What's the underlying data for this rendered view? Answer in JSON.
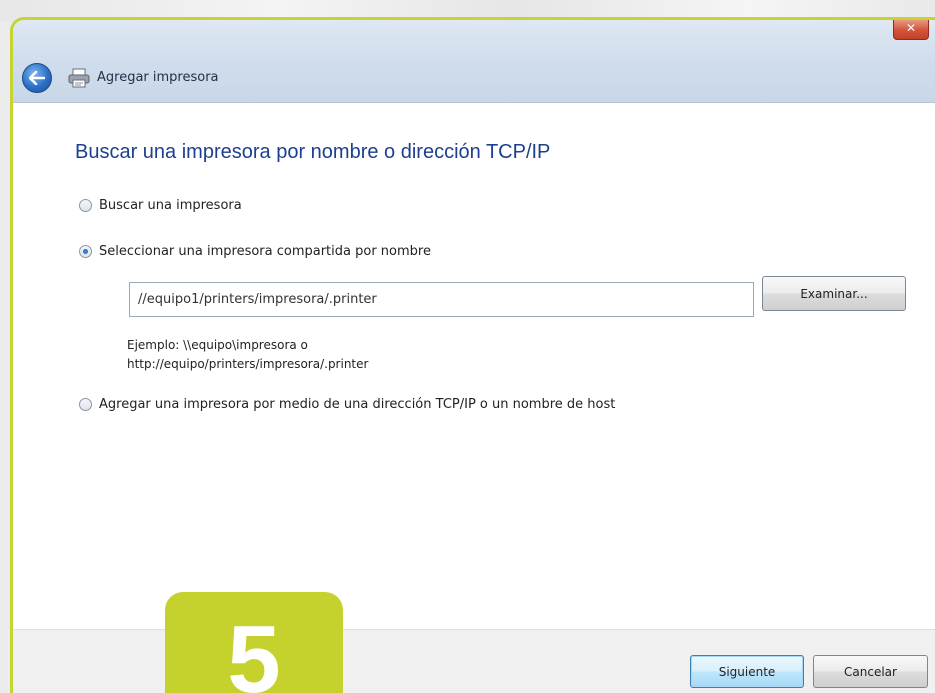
{
  "window": {
    "title": "Agregar impresora",
    "close_label": "✕",
    "accent_color": "#c6d432"
  },
  "main": {
    "heading": "Buscar una impresora por nombre o dirección TCP/IP",
    "options": [
      {
        "label": "Buscar una impresora",
        "checked": false
      },
      {
        "label": "Seleccionar una impresora compartida por nombre",
        "checked": true
      },
      {
        "label": "Agregar una impresora por medio de una dirección TCP/IP o un nombre de host",
        "checked": false
      }
    ],
    "shared_printer_path": "//equipo1/printers/impresora/.printer",
    "browse_label": "Examinar...",
    "example_line1": "Ejemplo: \\\\equipo\\impresora o",
    "example_line2": "http://equipo/printers/impresora/.printer"
  },
  "footer": {
    "next_label": "Siguiente",
    "cancel_label": "Cancelar"
  },
  "overlay": {
    "step_number": "5",
    "badge_color": "#c5d22d"
  }
}
